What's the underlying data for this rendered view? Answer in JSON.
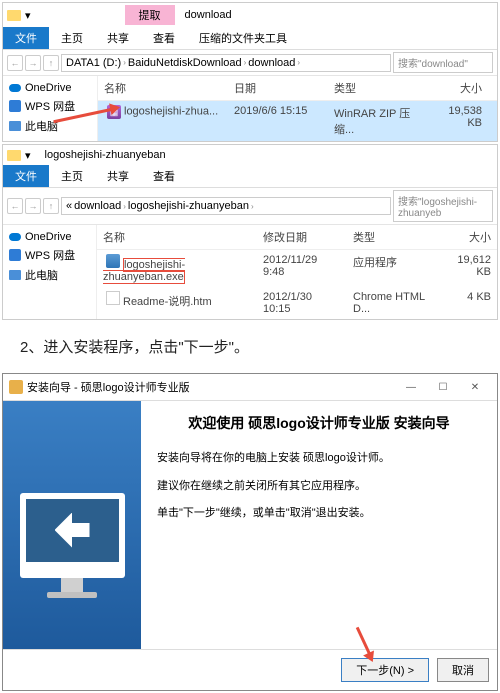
{
  "explorer1": {
    "title": "download",
    "pink_tab": "提取",
    "tabs": {
      "file": "文件",
      "home": "主页",
      "share": "共享",
      "view": "查看",
      "tools": "压缩的文件夹工具"
    },
    "breadcrumb": [
      "DATA1 (D:)",
      "BaiduNetdiskDownload",
      "download"
    ],
    "search": "搜索\"download\"",
    "sidebar": {
      "onedrive": "OneDrive",
      "wps": "WPS 网盘",
      "pc": "此电脑"
    },
    "columns": {
      "name": "名称",
      "date": "日期",
      "type": "类型",
      "size": "大小"
    },
    "file": {
      "name": "logoshejishi-zhua...",
      "date": "2019/6/6 15:15",
      "type": "WinRAR ZIP 压缩...",
      "size": "19,538 KB"
    }
  },
  "explorer2": {
    "title": "logoshejishi-zhuanyeban",
    "tabs": {
      "file": "文件",
      "home": "主页",
      "share": "共享",
      "view": "查看"
    },
    "breadcrumb": [
      "download",
      "logoshejishi-zhuanyeban"
    ],
    "search": "搜索\"logoshejishi-zhuanyeb",
    "sidebar": {
      "onedrive": "OneDrive",
      "wps": "WPS 网盘",
      "pc": "此电脑"
    },
    "columns": {
      "name": "名称",
      "date": "修改日期",
      "type": "类型",
      "size": "大小"
    },
    "files": [
      {
        "name": "logoshejishi-zhuanyeban.exe",
        "date": "2012/11/29 9:48",
        "type": "应用程序",
        "size": "19,612 KB"
      },
      {
        "name": "Readme-说明.htm",
        "date": "2012/1/30 10:15",
        "type": "Chrome HTML D...",
        "size": "4 KB"
      }
    ]
  },
  "instruction": "2、进入安装程序，点击\"下一步\"。",
  "installer": {
    "title": "安装向导 - 硕思logo设计师专业版",
    "heading": "欢迎使用 硕思logo设计师专业版 安装向导",
    "p1": "安装向导将在你的电脑上安装 硕思logo设计师。",
    "p2": "建议你在继续之前关闭所有其它应用程序。",
    "p3": "单击\"下一步\"继续，或单击\"取消\"退出安装。",
    "next": "下一步(N) >",
    "cancel": "取消"
  }
}
